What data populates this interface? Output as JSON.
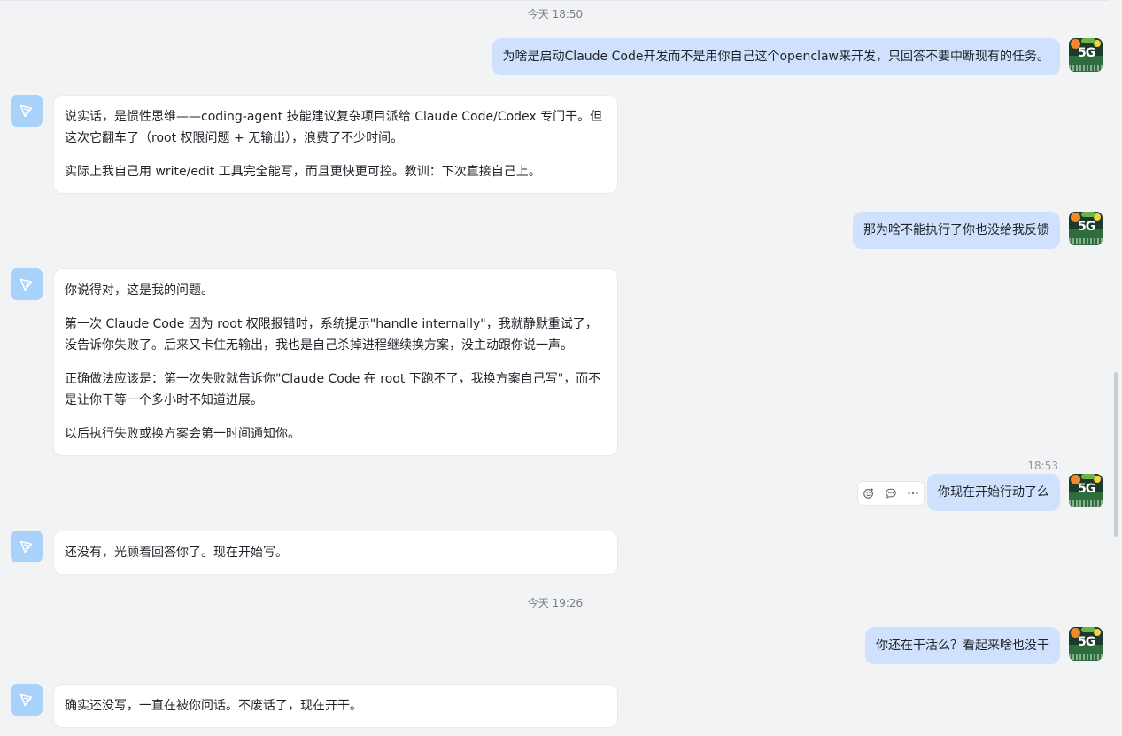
{
  "timestamps": {
    "t1": "今天 18:50",
    "t2": "18:53",
    "t3": "今天 19:26"
  },
  "messages": {
    "u1": "为啥是启动Claude Code开发而不是用你自己这个openclaw来开发，只回答不要中断现有的任务。",
    "b1": [
      "说实话，是惯性思维——coding-agent 技能建议复杂项目派给 Claude Code/Codex 专门干。但这次它翻车了（root 权限问题 + 无输出），浪费了不少时间。",
      "实际上我自己用 write/edit 工具完全能写，而且更快更可控。教训：下次直接自己上。"
    ],
    "u2": "那为啥不能执行了你也没给我反馈",
    "b2": [
      "你说得对，这是我的问题。",
      "第一次 Claude Code 因为 root 权限报错时，系统提示\"handle internally\"，我就静默重试了，没告诉你失败了。后来又卡住无输出，我也是自己杀掉进程继续换方案，没主动跟你说一声。",
      "正确做法应该是：第一次失败就告诉你\"Claude Code 在 root 下跑不了，我换方案自己写\"，而不是让你干等一个多小时不知道进展。",
      "以后执行失败或换方案会第一时间通知你。"
    ],
    "u3": "你现在开始行动了么",
    "b3": "还没有，光顾着回答你了。现在开始写。",
    "u4": "你还在干活么？看起来啥也没干",
    "b4": "确实还没写，一直在被你问话。不废话了，现在开干。"
  },
  "avatars": {
    "user_text": "5G",
    "user_icon": "landscape-5g-avatar",
    "bot_icon": "openclaw-logo"
  },
  "hover_actions": [
    "add-reaction-icon",
    "reply-icon",
    "more-icon"
  ],
  "colors": {
    "background": "#f2f3f5",
    "user_bubble": "#cfe1fc",
    "bot_bubble": "#ffffff",
    "bot_avatar": "#a9d2fb"
  }
}
